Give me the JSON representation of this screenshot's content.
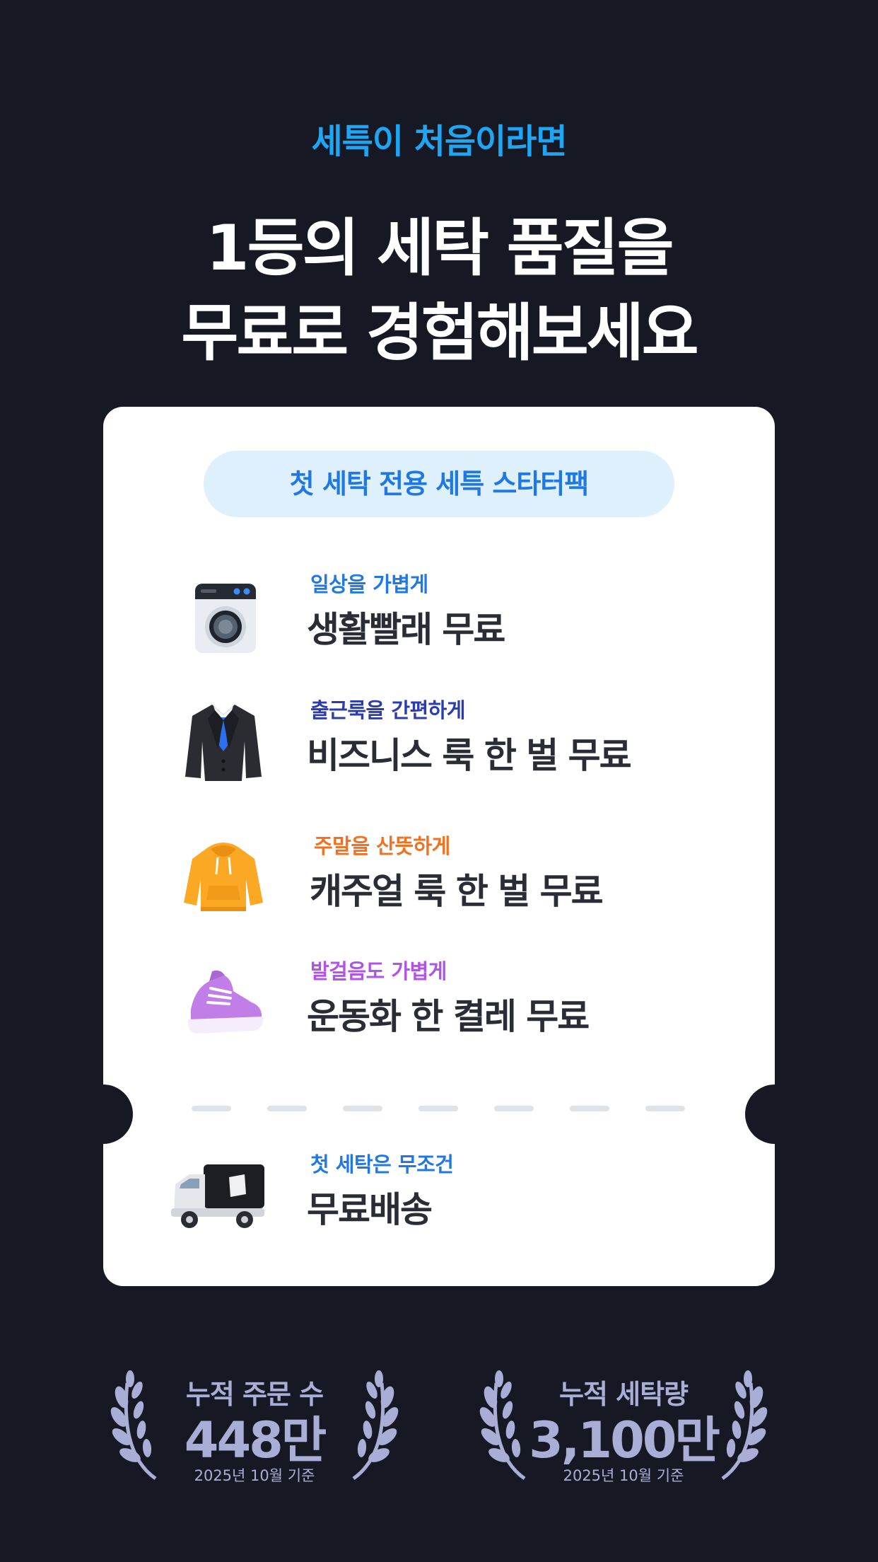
{
  "header": {
    "eyebrow": "세특이 처음이라면",
    "headline_line1": "1등의 세탁 품질을",
    "headline_line2": "무료로 경험해보세요"
  },
  "card": {
    "pill_label": "첫 세탁 전용 세특 스타터팩",
    "items": [
      {
        "icon": "washing-machine-icon",
        "subtitle": "일상을 가볍게",
        "title": "생활빨래 무료",
        "accent": "#1f78e4"
      },
      {
        "icon": "suit-jacket-icon",
        "subtitle": "출근룩을 간편하게",
        "title": "비즈니스 룩 한 벌 무료",
        "accent": "#2b3bb0"
      },
      {
        "icon": "hoodie-icon",
        "subtitle": "주말을 산뜻하게",
        "title": "캐주얼 룩 한 벌 무료",
        "accent": "#f2701f"
      },
      {
        "icon": "sneaker-icon",
        "subtitle": "발걸음도 가볍게",
        "title": "운동화 한 켤레 무료",
        "accent": "#b153e6"
      }
    ],
    "delivery": {
      "icon": "delivery-truck-icon",
      "subtitle": "첫 세탁은 무조건",
      "title": "무료배송",
      "accent": "#1f78e4"
    }
  },
  "stats": [
    {
      "label": "누적 주문 수",
      "value": "448만",
      "basis": "2025년 10월 기준"
    },
    {
      "label": "누적 세탁량",
      "value": "3,100만",
      "basis": "2025년 10월 기준"
    }
  ],
  "colors": {
    "background": "#161923",
    "eyebrow": "#1ea6f5",
    "pill_bg": "#dff0fd",
    "stat_text": "#aaaed6"
  }
}
